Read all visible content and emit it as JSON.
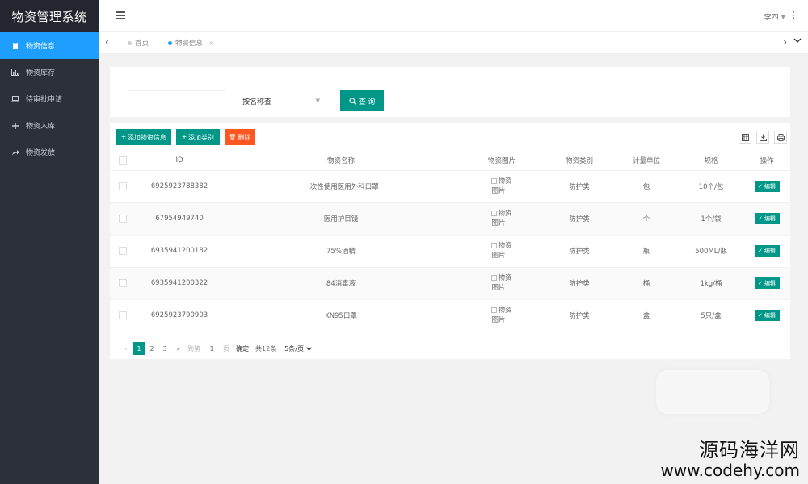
{
  "app": {
    "title": "物资管理系统"
  },
  "sidebar": {
    "items": [
      {
        "label": "物资信息",
        "icon": "book-icon",
        "active": true
      },
      {
        "label": "物资库存",
        "icon": "bar-chart-icon",
        "active": false
      },
      {
        "label": "待审批申请",
        "icon": "laptop-icon",
        "active": false
      },
      {
        "label": "物资入库",
        "icon": "plus-icon",
        "active": false
      },
      {
        "label": "物资发放",
        "icon": "share-icon",
        "active": false
      }
    ]
  },
  "header": {
    "user": "李四"
  },
  "tabs": [
    {
      "label": "首页",
      "active": false
    },
    {
      "label": "物资信息",
      "active": true,
      "close": "×"
    }
  ],
  "search": {
    "select_value": "按名称查",
    "query_label": "查 询"
  },
  "toolbar": {
    "add_label": "添加物资信息",
    "add_category_label": "添加类别",
    "delete_label": "删除"
  },
  "table": {
    "columns": [
      "ID",
      "物资名称",
      "物资图片",
      "物资类别",
      "计量单位",
      "规格",
      "操作"
    ],
    "image_alt": [
      "物资",
      "图片"
    ],
    "edit_label": "编辑",
    "rows": [
      {
        "id": "6925923788382",
        "name": "一次性使用医用外科口罩",
        "category": "防护类",
        "unit": "包",
        "spec": "10个/包"
      },
      {
        "id": "67954949740",
        "name": "医用护目镜",
        "category": "防护类",
        "unit": "个",
        "spec": "1个/袋"
      },
      {
        "id": "6935941200182",
        "name": "75%酒精",
        "category": "防护类",
        "unit": "瓶",
        "spec": "500ML/瓶"
      },
      {
        "id": "6935941200322",
        "name": "84消毒液",
        "category": "防护类",
        "unit": "桶",
        "spec": "1kg/桶"
      },
      {
        "id": "6925923790903",
        "name": "KN95口罩",
        "category": "防护类",
        "unit": "盒",
        "spec": "5只/盒"
      }
    ]
  },
  "pagination": {
    "pages": [
      "1",
      "2",
      "3"
    ],
    "current": "1",
    "goto_label": "到第",
    "goto_value": "1",
    "page_suffix": "页",
    "confirm_label": "确定",
    "total_label": "共12条",
    "page_size_label": "5条/页"
  },
  "watermark": {
    "cn": "源码海洋网",
    "url": "www.codehy.com"
  },
  "colors": {
    "accent": "#009688",
    "active_nav": "#1e9fff",
    "danger": "#ff5722",
    "sidebar": "#2c3039"
  }
}
